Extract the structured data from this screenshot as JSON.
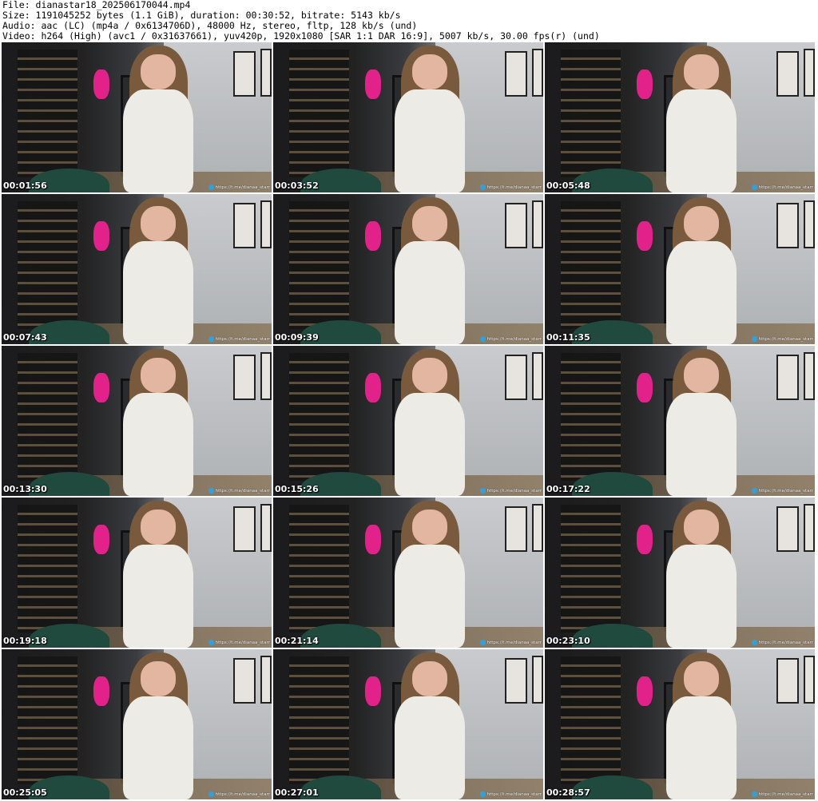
{
  "header": {
    "file_line": "File: dianastar18_202506170044.mp4",
    "size_line": "Size: 1191045252 bytes (1.1 GiB), duration: 00:30:52, bitrate: 5143 kb/s",
    "audio_line": "Audio: aac (LC) (mp4a / 0x6134706D), 48000 Hz, stereo, fltp, 128 kb/s (und)",
    "video_line": "Video: h264 (High) (avc1 / 0x31637661), yuv420p, 1920x1080 [SAR 1:1 DAR 16:9], 5007 kb/s, 30.00 fps(r) (und)"
  },
  "watermark_text": "https://t.me/dianaa_starr",
  "thumbnails": [
    {
      "timestamp": "00:01:56"
    },
    {
      "timestamp": "00:03:52"
    },
    {
      "timestamp": "00:05:48"
    },
    {
      "timestamp": "00:07:43"
    },
    {
      "timestamp": "00:09:39"
    },
    {
      "timestamp": "00:11:35"
    },
    {
      "timestamp": "00:13:30"
    },
    {
      "timestamp": "00:15:26"
    },
    {
      "timestamp": "00:17:22"
    },
    {
      "timestamp": "00:19:18"
    },
    {
      "timestamp": "00:21:14"
    },
    {
      "timestamp": "00:23:10"
    },
    {
      "timestamp": "00:25:05"
    },
    {
      "timestamp": "00:27:01"
    },
    {
      "timestamp": "00:28:57"
    }
  ],
  "colors": {
    "background": "#ffffff",
    "header_text": "#000000",
    "timestamp_text": "#ffffff",
    "telegram_icon": "#2aa3e0"
  },
  "icons": [
    "telegram-icon"
  ]
}
